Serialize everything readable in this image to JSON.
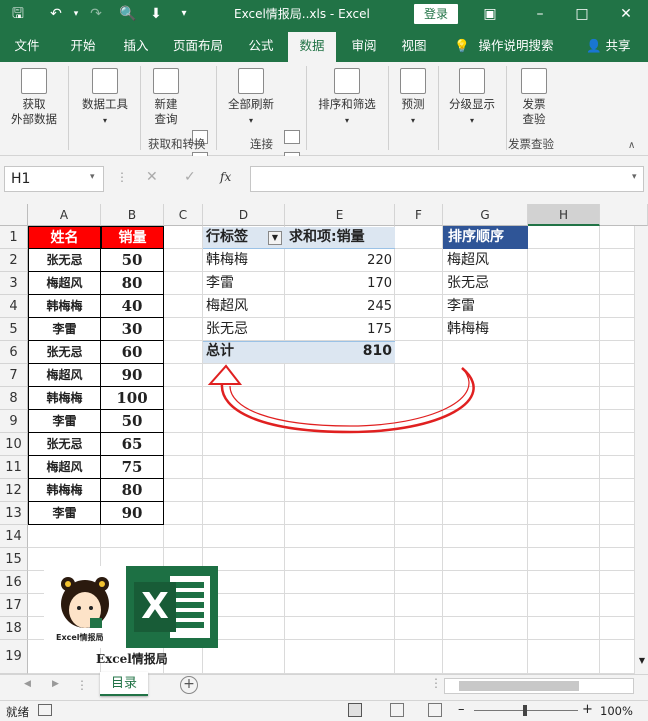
{
  "window": {
    "title": "Excel情报局..xls  -  Excel",
    "login_label": "登录"
  },
  "tabs": [
    "文件",
    "开始",
    "插入",
    "页面布局",
    "公式",
    "数据",
    "审阅",
    "视图"
  ],
  "tell_me": "操作说明搜索",
  "share": "共享",
  "ribbon": {
    "get_external": "获取\n外部数据",
    "data_tools": "数据工具",
    "new_query": "新建\n查询",
    "group_get_transform": "获取和转换",
    "refresh_all": "全部刷新",
    "group_connections": "连接",
    "sort_filter": "排序和筛选",
    "forecast": "预测",
    "outline": "分级显示",
    "invoice_check": "发票\n查验",
    "group_invoice": "发票查验"
  },
  "formula_bar": {
    "name_box": "H1",
    "fx": "fx",
    "formula": ""
  },
  "columns": [
    "A",
    "B",
    "C",
    "D",
    "E",
    "F",
    "G",
    "H"
  ],
  "rows": [
    "1",
    "2",
    "3",
    "4",
    "5",
    "6",
    "7",
    "8",
    "9",
    "10",
    "11",
    "12",
    "13",
    "14",
    "15",
    "16",
    "17",
    "18",
    "19"
  ],
  "source_table": {
    "header": [
      "姓名",
      "销量"
    ],
    "rows": [
      [
        "张无忌",
        "50"
      ],
      [
        "梅超风",
        "80"
      ],
      [
        "韩梅梅",
        "40"
      ],
      [
        "李雷",
        "30"
      ],
      [
        "张无忌",
        "60"
      ],
      [
        "梅超风",
        "90"
      ],
      [
        "韩梅梅",
        "100"
      ],
      [
        "李雷",
        "50"
      ],
      [
        "张无忌",
        "65"
      ],
      [
        "梅超风",
        "75"
      ],
      [
        "韩梅梅",
        "80"
      ],
      [
        "李雷",
        "90"
      ]
    ]
  },
  "pivot": {
    "header_label": "行标签",
    "header_value": "求和项:销量",
    "rows": [
      [
        "韩梅梅",
        "220"
      ],
      [
        "李雷",
        "170"
      ],
      [
        "梅超风",
        "245"
      ],
      [
        "张无忌",
        "175"
      ]
    ],
    "total_label": "总计",
    "total_value": "810"
  },
  "sort_order": {
    "header": "排序顺序",
    "items": [
      "梅超风",
      "张无忌",
      "李雷",
      "韩梅梅"
    ]
  },
  "logo_caption": "Excel情报局",
  "logo_badge": "Excel情报局",
  "sheet_tab": "目录",
  "status": {
    "ready": "就绪",
    "zoom": "100%"
  },
  "colors": {
    "excel_green": "#217346",
    "header_red": "#ff0000",
    "pivot_blue": "#dce6f1",
    "sort_header": "#2f5597"
  }
}
